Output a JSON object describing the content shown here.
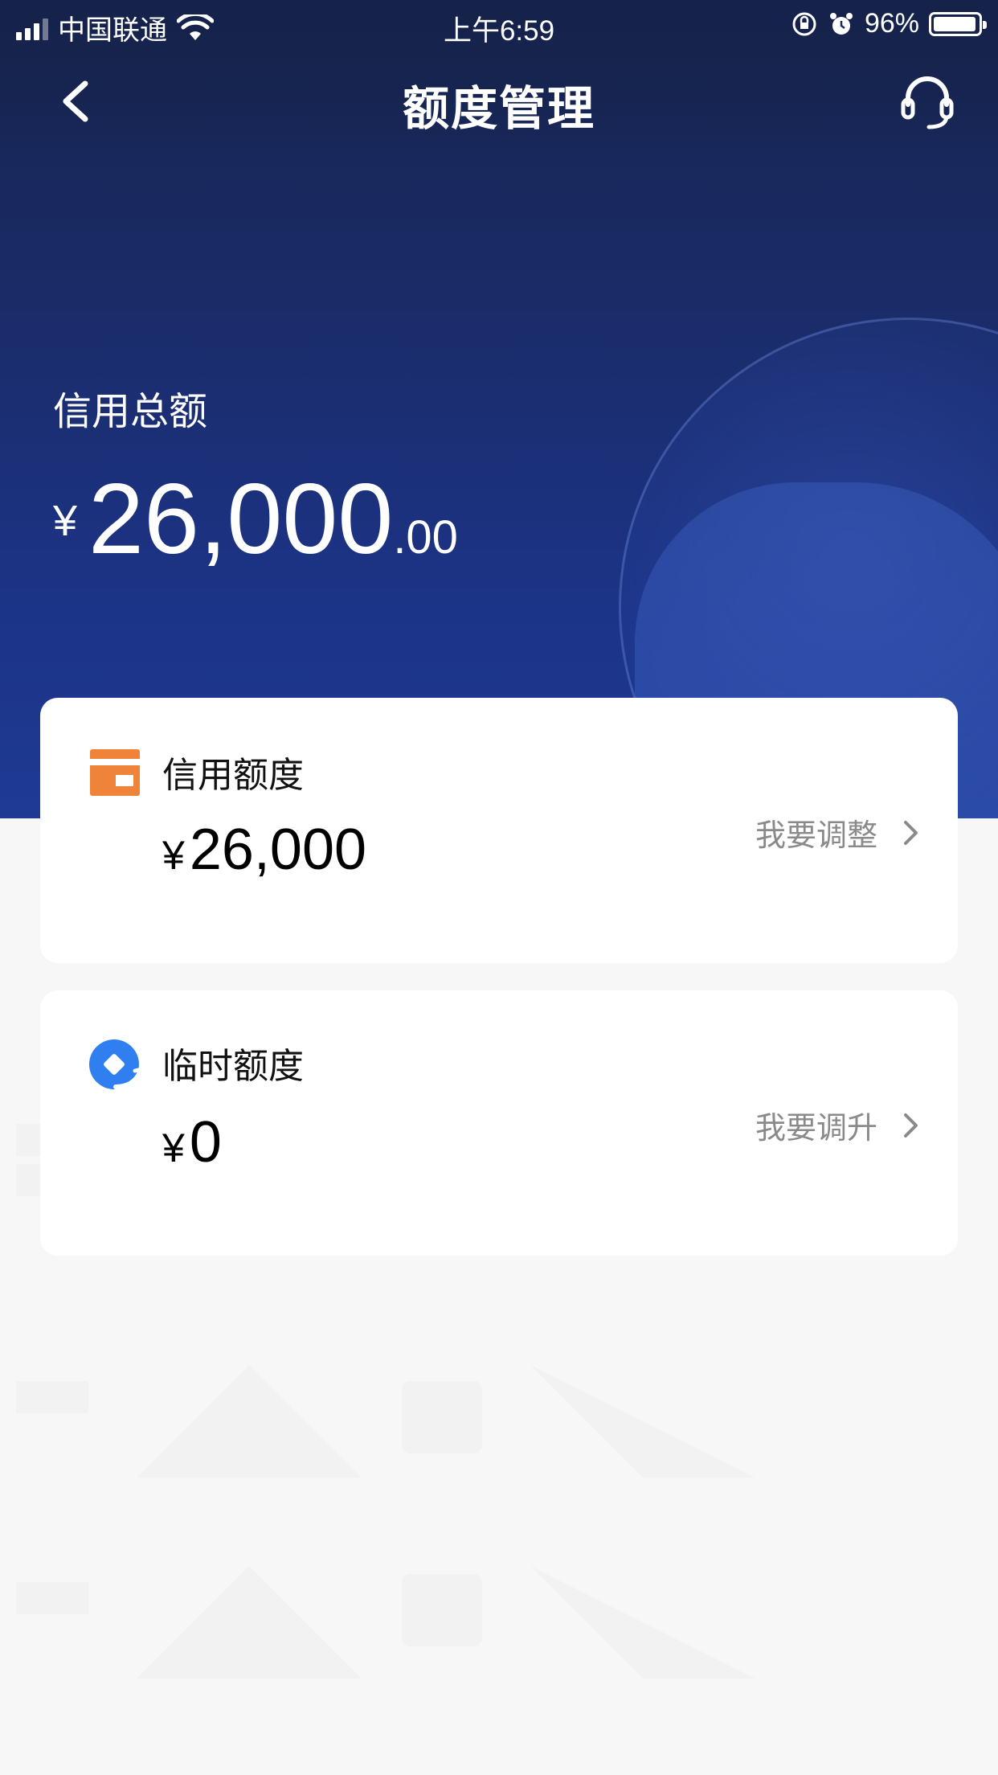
{
  "status_bar": {
    "carrier": "中国联通",
    "time": "上午6:59",
    "battery": "96%"
  },
  "nav": {
    "title": "额度管理"
  },
  "summary": {
    "label": "信用总额",
    "currency": "¥",
    "amount_integer": "26,000",
    "amount_decimal": ".00"
  },
  "cards": [
    {
      "title": "信用额度",
      "currency": "¥",
      "amount": "26,000",
      "action": "我要调整",
      "icon": "card-icon"
    },
    {
      "title": "临时额度",
      "currency": "¥",
      "amount": "0",
      "action": "我要调升",
      "icon": "temp-credit-icon"
    }
  ],
  "colors": {
    "header_top": "#15224a",
    "header_bottom": "#1e3a93",
    "card_icon_orange": "#f0833a",
    "temp_icon_blue": "#2f7ff0",
    "action_gray": "#8a8a8a",
    "page_bg": "#f7f7f7"
  }
}
